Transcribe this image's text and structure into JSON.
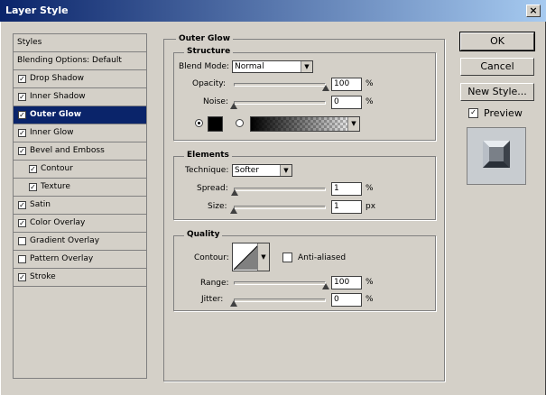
{
  "window": {
    "title": "Layer Style",
    "close_label": "×"
  },
  "styles_panel": {
    "header": "Styles",
    "items": [
      {
        "label": "Blending Options: Default",
        "checkbox": false,
        "checked": false,
        "selected": false,
        "sub": false
      },
      {
        "label": "Drop Shadow",
        "checkbox": true,
        "checked": true,
        "selected": false,
        "sub": false
      },
      {
        "label": "Inner Shadow",
        "checkbox": true,
        "checked": true,
        "selected": false,
        "sub": false
      },
      {
        "label": "Outer Glow",
        "checkbox": true,
        "checked": true,
        "selected": true,
        "sub": false
      },
      {
        "label": "Inner Glow",
        "checkbox": true,
        "checked": true,
        "selected": false,
        "sub": false
      },
      {
        "label": "Bevel and Emboss",
        "checkbox": true,
        "checked": true,
        "selected": false,
        "sub": false
      },
      {
        "label": "Contour",
        "checkbox": true,
        "checked": true,
        "selected": false,
        "sub": true
      },
      {
        "label": "Texture",
        "checkbox": true,
        "checked": true,
        "selected": false,
        "sub": true
      },
      {
        "label": "Satin",
        "checkbox": true,
        "checked": true,
        "selected": false,
        "sub": false
      },
      {
        "label": "Color Overlay",
        "checkbox": true,
        "checked": true,
        "selected": false,
        "sub": false
      },
      {
        "label": "Gradient Overlay",
        "checkbox": true,
        "checked": false,
        "selected": false,
        "sub": false
      },
      {
        "label": "Pattern Overlay",
        "checkbox": true,
        "checked": false,
        "selected": false,
        "sub": false
      },
      {
        "label": "Stroke",
        "checkbox": true,
        "checked": true,
        "selected": false,
        "sub": false
      }
    ]
  },
  "outer_glow": {
    "title": "Outer Glow",
    "structure": {
      "title": "Structure",
      "blend_mode_label": "Blend Mode:",
      "blend_mode_value": "Normal",
      "opacity_label": "Opacity:",
      "opacity_value": "100",
      "opacity_unit": "%",
      "opacity_level": 1.0,
      "noise_label": "Noise:",
      "noise_value": "0",
      "noise_unit": "%",
      "noise_level": 0.0,
      "color_swatch": "#000000",
      "color_selected": true,
      "gradient_selected": false
    },
    "elements": {
      "title": "Elements",
      "technique_label": "Technique:",
      "technique_value": "Softer",
      "spread_label": "Spread:",
      "spread_value": "1",
      "spread_unit": "%",
      "spread_level": 0.01,
      "size_label": "Size:",
      "size_value": "1",
      "size_unit": "px",
      "size_level": 0.004
    },
    "quality": {
      "title": "Quality",
      "contour_label": "Contour:",
      "anti_aliased_label": "Anti-aliased",
      "anti_aliased_checked": false,
      "range_label": "Range:",
      "range_value": "100",
      "range_unit": "%",
      "range_level": 1.0,
      "jitter_label": "Jitter:",
      "jitter_value": "0",
      "jitter_unit": "%",
      "jitter_level": 0.0
    }
  },
  "buttons": {
    "ok": "OK",
    "cancel": "Cancel",
    "new_style": "New Style..."
  },
  "preview": {
    "label": "Preview",
    "checked": true
  }
}
